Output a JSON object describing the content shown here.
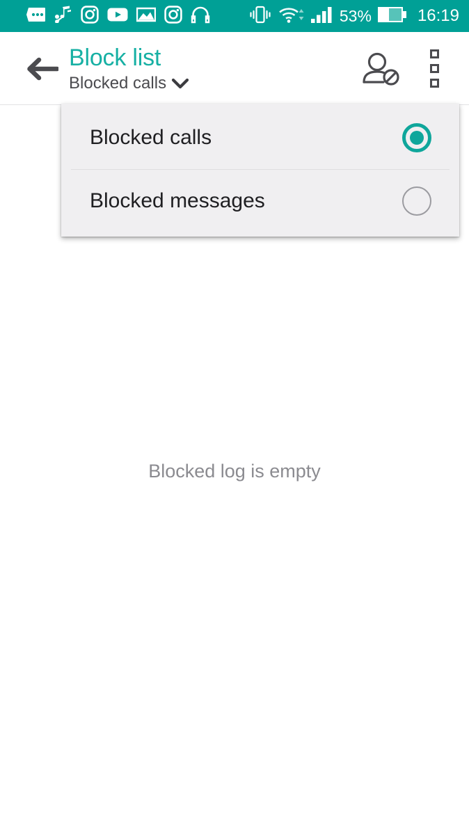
{
  "status_bar": {
    "background_color": "#00a096",
    "foreground_color": "#ffffff",
    "notification_icons": [
      "messages-icon",
      "music-note-icon",
      "instagram-icon",
      "youtube-icon",
      "gallery-icon",
      "instagram-icon",
      "headphones-icon"
    ],
    "system_icons": [
      "vibrate-icon",
      "wifi-icon",
      "signal-bars-icon"
    ],
    "battery_percent": "53%",
    "clock": "16:19"
  },
  "app_bar": {
    "back_icon": "arrow-left-icon",
    "title": "Block list",
    "title_color": "#17b0a4",
    "subtitle": "Blocked calls",
    "subtitle_chevron": "chevron-down-icon",
    "actions": [
      {
        "name": "block-contact-icon",
        "label": "Block contact"
      },
      {
        "name": "overflow-menu-icon",
        "label": "More options"
      }
    ]
  },
  "dropdown": {
    "background_color": "#f0eff1",
    "accent_color": "#0fa69b",
    "items": [
      {
        "label": "Blocked calls",
        "selected": true
      },
      {
        "label": "Blocked messages",
        "selected": false
      }
    ]
  },
  "content": {
    "empty_state_text": "Blocked log is empty",
    "empty_state_color": "#8b8b90"
  }
}
